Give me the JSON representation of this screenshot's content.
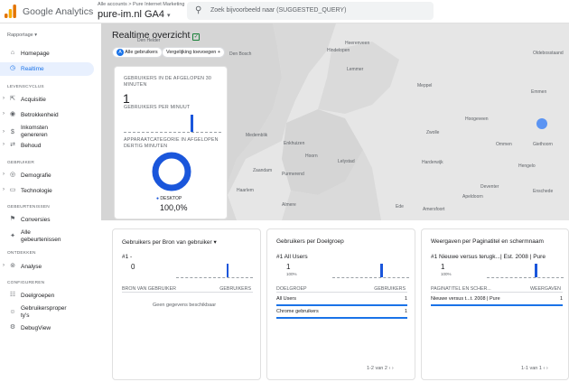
{
  "header": {
    "brand": "Google Analytics",
    "breadcrumb": "Alle accounts > Pure Internet Marketing",
    "property": "pure-im.nl GA4",
    "search_placeholder": "Zoek bijvoorbeeld naar (SUGGESTED_QUERY)"
  },
  "sidebar": {
    "reports_label": "Rapportage",
    "items": [
      {
        "label": "Homepage",
        "icon": "home-icon"
      },
      {
        "label": "Realtime",
        "icon": "clock-icon",
        "active": true
      }
    ],
    "sections": [
      {
        "title": "LEVENSCYCLUS",
        "items": [
          "Acquisitie",
          "Betrokkenheid",
          "Inkomsten genereren",
          "Behoud"
        ]
      },
      {
        "title": "GEBRUIKER",
        "items": [
          "Demografie",
          "Technologie"
        ]
      },
      {
        "title": "GEBEURTENISSEN",
        "items": [
          "Conversies",
          "Alle gebeurtenissen"
        ]
      },
      {
        "title": "ONTDEKKEN",
        "items": [
          "Analyse"
        ]
      },
      {
        "title": "CONFIGUREREN",
        "items": [
          "Doelgroepen",
          "Gebruikersproper ty's",
          "DebugView"
        ]
      }
    ]
  },
  "page": {
    "title": "Realtime overzicht",
    "chip_all_users": "Alle gebruikers",
    "chip_compare": "Vergelijking toevoegen"
  },
  "map": {
    "labels": [
      "Den Helder",
      "Heerenveen",
      "Den Bosch",
      "Oldebosstaand",
      "Hindelopen",
      "Lemmer",
      "Meppel",
      "Emmen",
      "Harderwijk",
      "Hoogeveen",
      "Deventer",
      "Zwolle",
      "Medemblik",
      "Enkhuizen",
      "Almere",
      "Lelystad",
      "Amersfoort",
      "Haarlem",
      "Hoorn",
      "Purmerend",
      "Zaandam",
      "Apeldoorn",
      "Ede",
      "Enschede",
      "Hengelo",
      "Giethoorn",
      "Ommen"
    ]
  },
  "realtime": {
    "users_30_label": "GEBRUIKERS IN DE AFGELOPEN 30 MINUTEN",
    "users_30_value": "1",
    "per_minute_label": "GEBRUIKERS PER MINUUT",
    "device_label": "APPARAATCATEGORIE IN AFGELOPEN DERTIG MINUTEN",
    "device_name": "DESKTOP",
    "device_pct": "100,0%",
    "device_share": 1.0,
    "color": "#1a56db"
  },
  "cards": [
    {
      "title": "Gebruikers per Bron van gebruiker",
      "rank": "#1  -",
      "value": "0",
      "pct": "",
      "col1": "BRON VAN GEBRUIKER",
      "col2": "GEBRUIKERS",
      "empty": "Geen gegevens beschikbaar",
      "rows": [],
      "pager": ""
    },
    {
      "title": "Gebruikers  per Doelgroep",
      "rank": "#1  All Users",
      "value": "1",
      "pct": "100%",
      "col1": "DOELGROEP",
      "col2": "GEBRUIKERS",
      "empty": "",
      "rows": [
        {
          "name": "All Users",
          "val": "1"
        },
        {
          "name": "Chrome gebruikers",
          "val": "1"
        }
      ],
      "pager": "1-2 van 2"
    },
    {
      "title": "Weergaven per Paginatitel en schermnaam",
      "rank": "#1  Nieuwe versus terugk...| Est. 2008 | Pure",
      "value": "1",
      "pct": "100%",
      "col1": "PAGINATITEL EN SCHER...",
      "col2": "WEERGAVEN",
      "empty": "",
      "rows": [
        {
          "name": "Nieuwe versus t...t. 2008 | Pure",
          "val": "1"
        }
      ],
      "pager": "1-1 van 1"
    }
  ]
}
